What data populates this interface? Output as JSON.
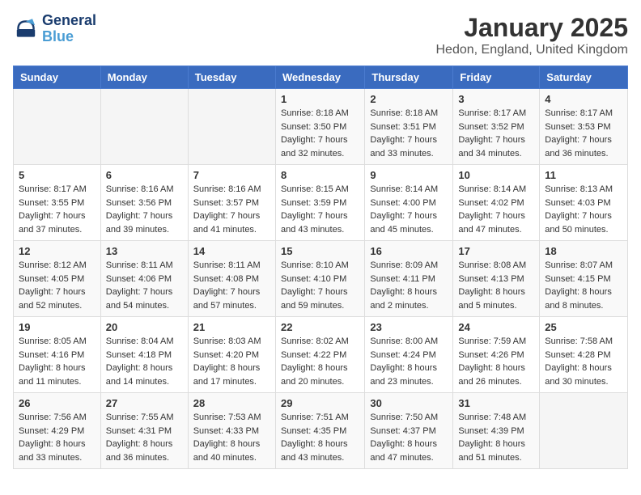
{
  "logo": {
    "line1": "General",
    "line2": "Blue"
  },
  "title": "January 2025",
  "subtitle": "Hedon, England, United Kingdom",
  "days_of_week": [
    "Sunday",
    "Monday",
    "Tuesday",
    "Wednesday",
    "Thursday",
    "Friday",
    "Saturday"
  ],
  "weeks": [
    [
      {
        "day": "",
        "sunrise": "",
        "sunset": "",
        "daylight": ""
      },
      {
        "day": "",
        "sunrise": "",
        "sunset": "",
        "daylight": ""
      },
      {
        "day": "",
        "sunrise": "",
        "sunset": "",
        "daylight": ""
      },
      {
        "day": "1",
        "sunrise": "Sunrise: 8:18 AM",
        "sunset": "Sunset: 3:50 PM",
        "daylight": "Daylight: 7 hours and 32 minutes."
      },
      {
        "day": "2",
        "sunrise": "Sunrise: 8:18 AM",
        "sunset": "Sunset: 3:51 PM",
        "daylight": "Daylight: 7 hours and 33 minutes."
      },
      {
        "day": "3",
        "sunrise": "Sunrise: 8:17 AM",
        "sunset": "Sunset: 3:52 PM",
        "daylight": "Daylight: 7 hours and 34 minutes."
      },
      {
        "day": "4",
        "sunrise": "Sunrise: 8:17 AM",
        "sunset": "Sunset: 3:53 PM",
        "daylight": "Daylight: 7 hours and 36 minutes."
      }
    ],
    [
      {
        "day": "5",
        "sunrise": "Sunrise: 8:17 AM",
        "sunset": "Sunset: 3:55 PM",
        "daylight": "Daylight: 7 hours and 37 minutes."
      },
      {
        "day": "6",
        "sunrise": "Sunrise: 8:16 AM",
        "sunset": "Sunset: 3:56 PM",
        "daylight": "Daylight: 7 hours and 39 minutes."
      },
      {
        "day": "7",
        "sunrise": "Sunrise: 8:16 AM",
        "sunset": "Sunset: 3:57 PM",
        "daylight": "Daylight: 7 hours and 41 minutes."
      },
      {
        "day": "8",
        "sunrise": "Sunrise: 8:15 AM",
        "sunset": "Sunset: 3:59 PM",
        "daylight": "Daylight: 7 hours and 43 minutes."
      },
      {
        "day": "9",
        "sunrise": "Sunrise: 8:14 AM",
        "sunset": "Sunset: 4:00 PM",
        "daylight": "Daylight: 7 hours and 45 minutes."
      },
      {
        "day": "10",
        "sunrise": "Sunrise: 8:14 AM",
        "sunset": "Sunset: 4:02 PM",
        "daylight": "Daylight: 7 hours and 47 minutes."
      },
      {
        "day": "11",
        "sunrise": "Sunrise: 8:13 AM",
        "sunset": "Sunset: 4:03 PM",
        "daylight": "Daylight: 7 hours and 50 minutes."
      }
    ],
    [
      {
        "day": "12",
        "sunrise": "Sunrise: 8:12 AM",
        "sunset": "Sunset: 4:05 PM",
        "daylight": "Daylight: 7 hours and 52 minutes."
      },
      {
        "day": "13",
        "sunrise": "Sunrise: 8:11 AM",
        "sunset": "Sunset: 4:06 PM",
        "daylight": "Daylight: 7 hours and 54 minutes."
      },
      {
        "day": "14",
        "sunrise": "Sunrise: 8:11 AM",
        "sunset": "Sunset: 4:08 PM",
        "daylight": "Daylight: 7 hours and 57 minutes."
      },
      {
        "day": "15",
        "sunrise": "Sunrise: 8:10 AM",
        "sunset": "Sunset: 4:10 PM",
        "daylight": "Daylight: 7 hours and 59 minutes."
      },
      {
        "day": "16",
        "sunrise": "Sunrise: 8:09 AM",
        "sunset": "Sunset: 4:11 PM",
        "daylight": "Daylight: 8 hours and 2 minutes."
      },
      {
        "day": "17",
        "sunrise": "Sunrise: 8:08 AM",
        "sunset": "Sunset: 4:13 PM",
        "daylight": "Daylight: 8 hours and 5 minutes."
      },
      {
        "day": "18",
        "sunrise": "Sunrise: 8:07 AM",
        "sunset": "Sunset: 4:15 PM",
        "daylight": "Daylight: 8 hours and 8 minutes."
      }
    ],
    [
      {
        "day": "19",
        "sunrise": "Sunrise: 8:05 AM",
        "sunset": "Sunset: 4:16 PM",
        "daylight": "Daylight: 8 hours and 11 minutes."
      },
      {
        "day": "20",
        "sunrise": "Sunrise: 8:04 AM",
        "sunset": "Sunset: 4:18 PM",
        "daylight": "Daylight: 8 hours and 14 minutes."
      },
      {
        "day": "21",
        "sunrise": "Sunrise: 8:03 AM",
        "sunset": "Sunset: 4:20 PM",
        "daylight": "Daylight: 8 hours and 17 minutes."
      },
      {
        "day": "22",
        "sunrise": "Sunrise: 8:02 AM",
        "sunset": "Sunset: 4:22 PM",
        "daylight": "Daylight: 8 hours and 20 minutes."
      },
      {
        "day": "23",
        "sunrise": "Sunrise: 8:00 AM",
        "sunset": "Sunset: 4:24 PM",
        "daylight": "Daylight: 8 hours and 23 minutes."
      },
      {
        "day": "24",
        "sunrise": "Sunrise: 7:59 AM",
        "sunset": "Sunset: 4:26 PM",
        "daylight": "Daylight: 8 hours and 26 minutes."
      },
      {
        "day": "25",
        "sunrise": "Sunrise: 7:58 AM",
        "sunset": "Sunset: 4:28 PM",
        "daylight": "Daylight: 8 hours and 30 minutes."
      }
    ],
    [
      {
        "day": "26",
        "sunrise": "Sunrise: 7:56 AM",
        "sunset": "Sunset: 4:29 PM",
        "daylight": "Daylight: 8 hours and 33 minutes."
      },
      {
        "day": "27",
        "sunrise": "Sunrise: 7:55 AM",
        "sunset": "Sunset: 4:31 PM",
        "daylight": "Daylight: 8 hours and 36 minutes."
      },
      {
        "day": "28",
        "sunrise": "Sunrise: 7:53 AM",
        "sunset": "Sunset: 4:33 PM",
        "daylight": "Daylight: 8 hours and 40 minutes."
      },
      {
        "day": "29",
        "sunrise": "Sunrise: 7:51 AM",
        "sunset": "Sunset: 4:35 PM",
        "daylight": "Daylight: 8 hours and 43 minutes."
      },
      {
        "day": "30",
        "sunrise": "Sunrise: 7:50 AM",
        "sunset": "Sunset: 4:37 PM",
        "daylight": "Daylight: 8 hours and 47 minutes."
      },
      {
        "day": "31",
        "sunrise": "Sunrise: 7:48 AM",
        "sunset": "Sunset: 4:39 PM",
        "daylight": "Daylight: 8 hours and 51 minutes."
      },
      {
        "day": "",
        "sunrise": "",
        "sunset": "",
        "daylight": ""
      }
    ]
  ]
}
